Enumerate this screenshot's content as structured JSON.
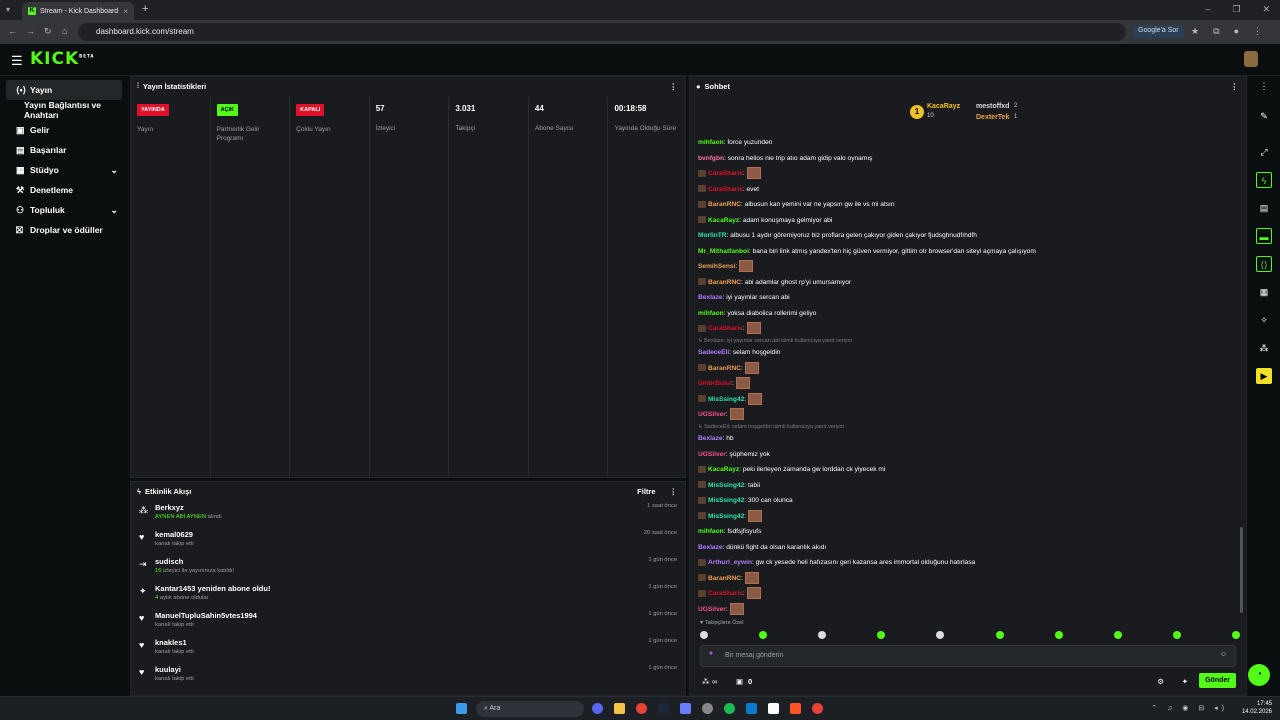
{
  "browser": {
    "tab_title": "Stream - Kick Dashboard",
    "url": "dashboard.kick.com/stream",
    "google_chip": "Google'a Sor"
  },
  "app": {
    "logo": "KICK",
    "logo_tag": "BETA"
  },
  "sidebar": {
    "items": [
      {
        "label": "Yayın",
        "icon": "broadcast-icon",
        "active": true
      },
      {
        "label": "Yayın Bağlantısı ve Anahtarı",
        "icon": "",
        "sub": true
      },
      {
        "label": "Gelir",
        "icon": "money-icon"
      },
      {
        "label": "Başarılar",
        "icon": "trophy-icon"
      },
      {
        "label": "Stüdyo",
        "icon": "studio-icon",
        "chevron": true
      },
      {
        "label": "Denetleme",
        "icon": "hammer-icon"
      },
      {
        "label": "Topluluk",
        "icon": "community-icon",
        "chevron": true
      },
      {
        "label": "Droplar ve ödüller",
        "icon": "gift-icon"
      }
    ]
  },
  "stats": {
    "title": "Yayın İstatistikleri",
    "cells": [
      {
        "badge": "YAYINDA",
        "badge_color": "#e0112b",
        "label": "Yayın"
      },
      {
        "badge": "AÇIK",
        "badge_color": "#53fc18",
        "label": "Partnerlik Gelir Programı"
      },
      {
        "badge": "KAPALI",
        "badge_color": "#e0112b",
        "label": "Çoklu Yayın"
      },
      {
        "value": "57",
        "label": "İzleyici"
      },
      {
        "value": "3.031",
        "label": "Takipçi"
      },
      {
        "value": "44",
        "label": "Abone Sayısı"
      },
      {
        "value": "00:18:58",
        "label": "Yayında Olduğu Süre"
      }
    ]
  },
  "events": {
    "title": "Etkinlik Akışı",
    "filter_label": "Filtre",
    "items": [
      {
        "icon": "gift-sub-icon",
        "name": "Berkxyz",
        "detail_green": "AYNEN ABİ AYNEN",
        "detail": " alındı",
        "time": "1 saat önce"
      },
      {
        "icon": "heart-icon",
        "name": "kemal0629",
        "detail_green": "",
        "detail": "kanalı takip etti",
        "time": "20 saat önce"
      },
      {
        "icon": "raid-icon",
        "name": "sudisch",
        "detail_green": "16",
        "detail": " izleyici ile yayınınıza katıldı!",
        "time": "1 gün önce"
      },
      {
        "icon": "sparkle-icon",
        "name": "Kantar1453 yeniden abone oldu!",
        "detail_green": "4",
        "detail": " aylık abone oldular",
        "time": "1 gün önce"
      },
      {
        "icon": "heart-icon",
        "name": "ManuelTupluSahin5vtes1994",
        "detail_green": "",
        "detail": "kanalı takip etti",
        "time": "1 gün önce"
      },
      {
        "icon": "heart-icon",
        "name": "knakles1",
        "detail_green": "",
        "detail": "kanalı takip etti",
        "time": "1 gün önce"
      },
      {
        "icon": "heart-icon",
        "name": "kuulayi",
        "detail_green": "",
        "detail": "kanalı takip etti",
        "time": "1 gün önce"
      }
    ]
  },
  "chat": {
    "title": "Sohbet",
    "top_chatters": {
      "first": {
        "name": "KacaRayz",
        "count": "10"
      },
      "second": {
        "name": "mestoffxd",
        "count": "2"
      },
      "third": {
        "name": "DexterTek",
        "count": "1"
      }
    },
    "messages": [
      {
        "user": "mihfaon",
        "color": "#53fc18",
        "text": "force yuzunden"
      },
      {
        "user": "bvnfgbn",
        "color": "#ff6fae",
        "text": "sonra helios nie trip atıo adam gidip valo oynamış"
      },
      {
        "user": "CaraSharis",
        "color": "#e0112b",
        "badge": true,
        "emote": true,
        "text": ""
      },
      {
        "user": "CaraSharis",
        "color": "#e0112b",
        "badge": true,
        "text": "evet"
      },
      {
        "user": "BaranRNC",
        "color": "#f0a050",
        "badge": true,
        "text": "albusun kan yemini var ne yapsın gw ile vs mi atsın"
      },
      {
        "user": "KacaRayz",
        "color": "#53fc18",
        "badge": true,
        "text": "adam konuşmaya gelmiyor abi"
      },
      {
        "user": "MorlinTR",
        "color": "#2ee6a8",
        "text": "albusu 1 aydır göremiyoruz biz proflara gelen çakıyor giden çakıyor fjudsghnudfıhdfh"
      },
      {
        "user": "Mr_Mithatfanboi",
        "color": "#53fc18",
        "text": "bana biri link atmış yandex'ten hiç güven vermiyor, gittim otr browser'dan siteyi açmaya çalışıyom"
      },
      {
        "user": "SemihSensi",
        "color": "#f0a050",
        "emote": true,
        "text": ""
      },
      {
        "user": "BaranRNC",
        "color": "#f0a050",
        "badge": true,
        "text": "abi adamlar ghost rp'yi umursamıyor"
      },
      {
        "user": "Bexlaze",
        "color": "#b57cff",
        "text": "iyi yayınlar sercan abi"
      },
      {
        "user": "mihfaon",
        "color": "#53fc18",
        "text": "yoksa diabolica rollerimi geliyo"
      },
      {
        "user": "CaraSharis",
        "color": "#e0112b",
        "badge": true,
        "emote": true,
        "text": ""
      },
      {
        "reply": "↳ Bexlaze: iyi yayınlar sercan abi isimli kullanıcıya yanıt veriyor"
      },
      {
        "user": "SadeceEli",
        "color": "#b57cff",
        "text": "selam hoşgeldin"
      },
      {
        "user": "BaranRNC",
        "color": "#f0a050",
        "badge": true,
        "emote": true,
        "text": ""
      },
      {
        "user": "UmbrBulut",
        "color": "#e0112b",
        "emote": true,
        "text": ""
      },
      {
        "user": "MisSsing42",
        "color": "#2ee6a8",
        "badge": true,
        "emote": true,
        "text": ""
      },
      {
        "user": "UGSilver",
        "color": "#ff4f8b",
        "emote": true,
        "text": ""
      },
      {
        "reply": "↳ SadeceEli: selam hoşgeldin isimli kullanıcıya yanıt veriyor"
      },
      {
        "user": "Bexlaze",
        "color": "#b57cff",
        "text": "hb"
      },
      {
        "user": "UGSilver",
        "color": "#ff4f8b",
        "text": "şüphemiz yok"
      },
      {
        "user": "KacaRayz",
        "color": "#53fc18",
        "badge": true,
        "text": "peki ilerleyen zamanda gw lorddan ck yiyecek mi"
      },
      {
        "user": "MisSsing42",
        "color": "#2ee6a8",
        "badge": true,
        "text": "tabii"
      },
      {
        "user": "MisSsing42",
        "color": "#2ee6a8",
        "badge": true,
        "text": "300 can olunca"
      },
      {
        "user": "MisSsing42",
        "color": "#2ee6a8",
        "badge": true,
        "emote": true,
        "text": ""
      },
      {
        "user": "mihfaon",
        "color": "#53fc18",
        "text": "fsdfsjfisyufs"
      },
      {
        "user": "Bexlaze",
        "color": "#b57cff",
        "text": "dünkü fight da olsan karanlık akıdı"
      },
      {
        "user": "Arthurl_eywin",
        "color": "#b57cff",
        "badge": true,
        "text": "gw ck yesede heli hafızasını geri kazansa ares immortal olduğunu hatırlasa"
      },
      {
        "user": "BaranRNC",
        "color": "#f0a050",
        "badge": true,
        "emote": true,
        "text": ""
      },
      {
        "user": "CaraSharis",
        "color": "#e0112b",
        "badge": true,
        "emote": true,
        "text": ""
      },
      {
        "user": "UGSilver",
        "color": "#ff4f8b",
        "emote": true,
        "text": ""
      }
    ],
    "followers_only": "♥ Takipçilere Özel",
    "input_placeholder": "Bir mesaj gönderin",
    "viewers_count": "∞",
    "box_count": "0",
    "send_label": "Gönder"
  },
  "taskbar": {
    "search_placeholder": "Ara",
    "time": "17:45",
    "date": "14.02.2026"
  },
  "colors": {
    "accent": "#53fc18",
    "live": "#e0112b",
    "panel": "#191b1f"
  }
}
